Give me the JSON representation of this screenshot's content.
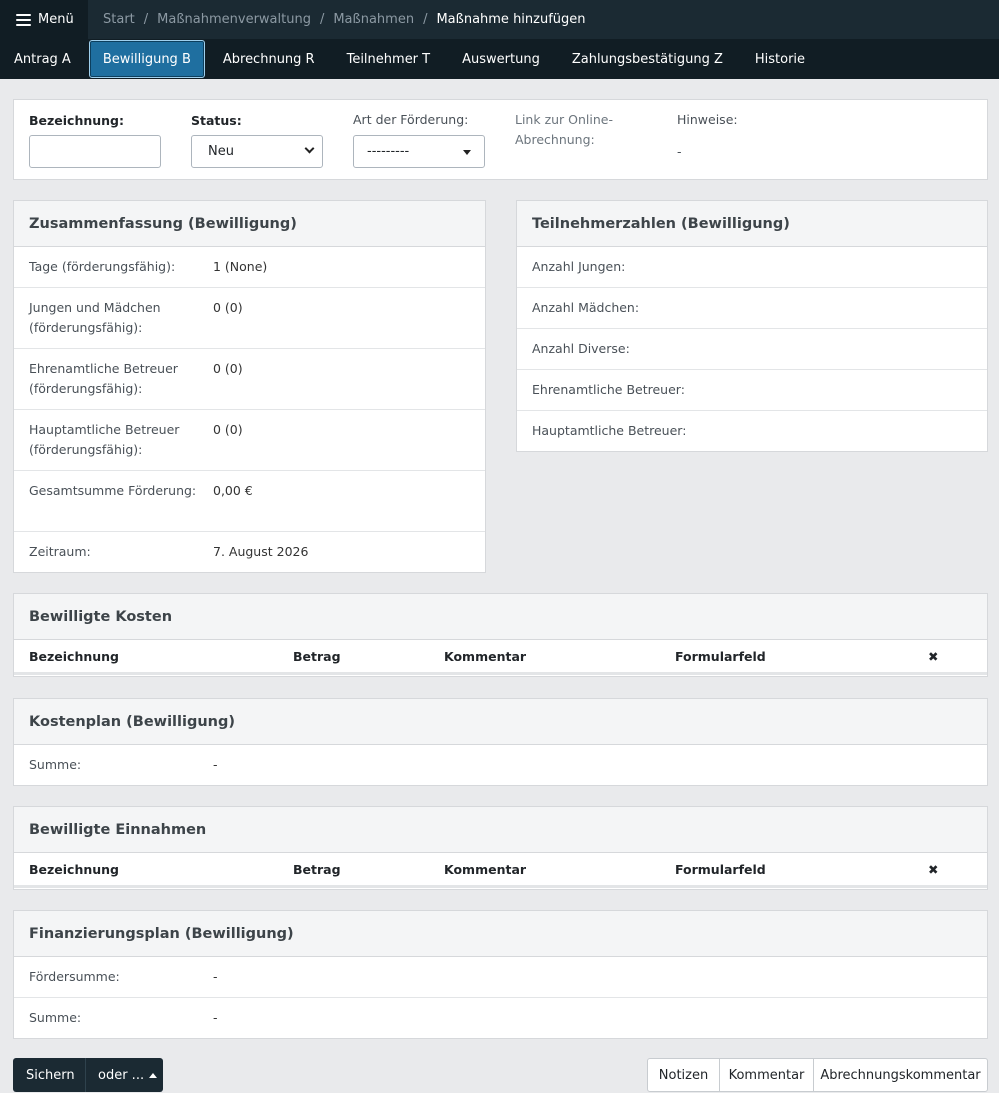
{
  "topbar": {
    "menu_label": "Menü",
    "breadcrumbs": [
      "Start",
      "Maßnahmenverwaltung",
      "Maßnahmen"
    ],
    "current": "Maßnahme hinzufügen"
  },
  "tabs": [
    "Antrag A",
    "Bewilligung B",
    "Abrechnung R",
    "Teilnehmer T",
    "Auswertung",
    "Zahlungsbestätigung Z",
    "Historie"
  ],
  "active_tab": "Bewilligung B",
  "form": {
    "bezeichnung_label": "Bezeichnung:",
    "bezeichnung_value": "",
    "status_label": "Status:",
    "status_value": "Neu",
    "art_label": "Art der Förderung:",
    "art_value": "---------",
    "link_label": "Link zur Online-Abrechnung:",
    "hinweise_label": "Hinweise:",
    "hinweise_value": "-"
  },
  "summary": {
    "title": "Zusammenfassung (Bewilligung)",
    "rows": [
      {
        "k": "Tage (förderungsfähig):",
        "v": "1 (None)"
      },
      {
        "k": "Jungen und Mädchen (förderungsfähig):",
        "v": "0 (0)"
      },
      {
        "k": "Ehrenamtliche Betreuer (förderungsfähig):",
        "v": "0 (0)"
      },
      {
        "k": "Hauptamtliche Betreuer (förderungsfähig):",
        "v": "0 (0)"
      },
      {
        "k": "Gesamtsumme Förderung:",
        "v": "0,00 €"
      },
      {
        "k": "Zeitraum:",
        "v": "7. August 2026"
      }
    ]
  },
  "participants": {
    "title": "Teilnehmerzahlen (Bewilligung)",
    "rows": [
      "Anzahl Jungen:",
      "Anzahl Mädchen:",
      "Anzahl Diverse:",
      "Ehrenamtliche Betreuer:",
      "Hauptamtliche Betreuer:"
    ]
  },
  "kosten": {
    "title": "Bewilligte Kosten",
    "headers": [
      "Bezeichnung",
      "Betrag",
      "Kommentar",
      "Formularfeld",
      "✖"
    ]
  },
  "kostenplan": {
    "title": "Kostenplan (Bewilligung)",
    "summe_label": "Summe:",
    "summe_value": "-"
  },
  "einnahmen": {
    "title": "Bewilligte Einnahmen",
    "headers": [
      "Bezeichnung",
      "Betrag",
      "Kommentar",
      "Formularfeld",
      "✖"
    ]
  },
  "finanzierungsplan": {
    "title": "Finanzierungsplan (Bewilligung)",
    "foerdersumme_label": "Fördersumme:",
    "foerdersumme_value": "-",
    "summe_label": "Summe:",
    "summe_value": "-"
  },
  "footer": {
    "save_label": "Sichern",
    "more_label": "oder ...",
    "notes_label": "Notizen",
    "comment_label": "Kommentar",
    "billing_comment_label": "Abrechnungskommentar"
  }
}
